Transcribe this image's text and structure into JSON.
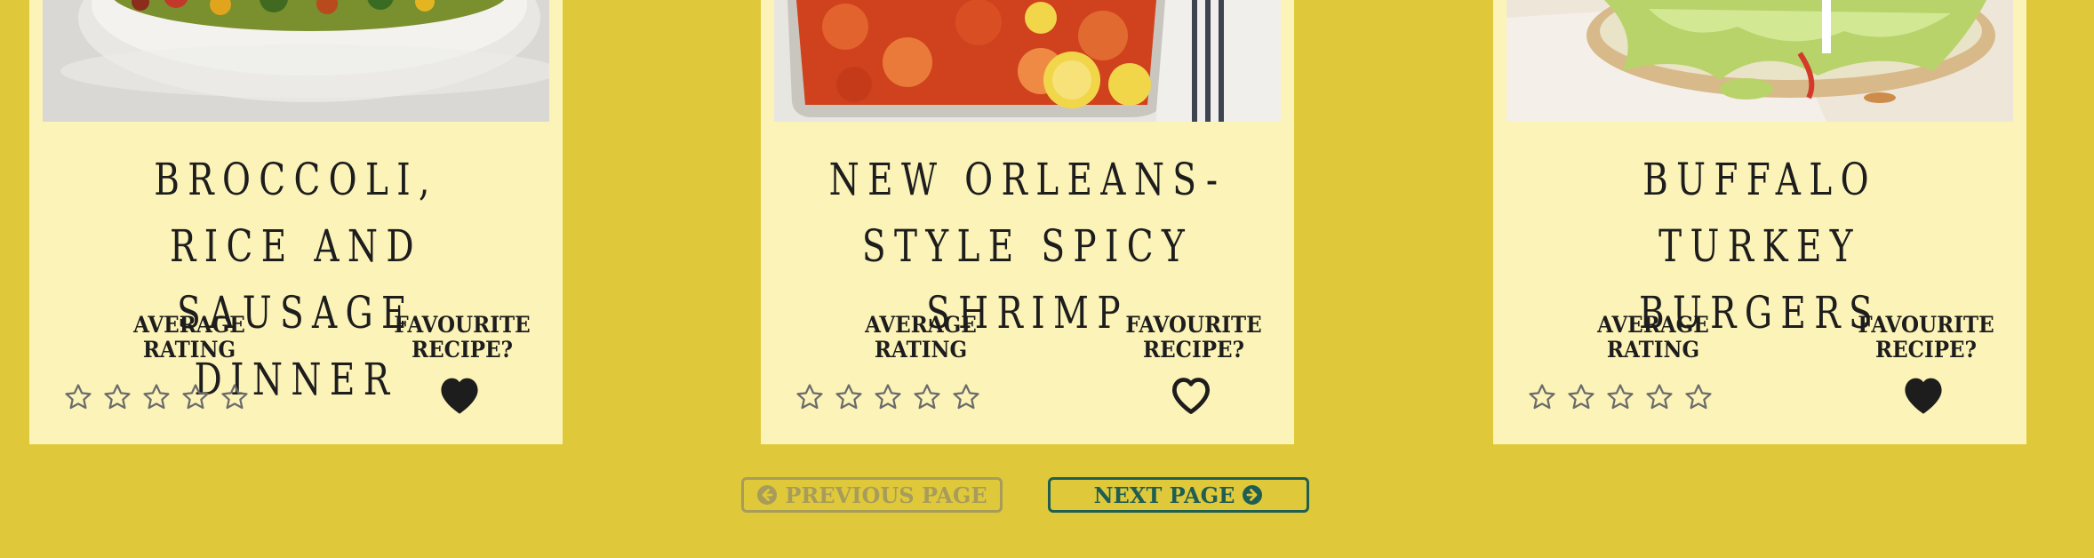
{
  "recipes": [
    {
      "title": "BROCCOLI, RICE AND SAUSAGE DINNER",
      "rating_label": "AVERAGE RATING",
      "favourite_label": "FAVOURITE RECIPE?",
      "rating_stars": 0,
      "favourite": true
    },
    {
      "title": "NEW ORLEANS-STYLE SPICY SHRIMP",
      "rating_label": "AVERAGE RATING",
      "favourite_label": "FAVOURITE RECIPE?",
      "rating_stars": 0,
      "favourite": false
    },
    {
      "title": "BUFFALO TURKEY BURGERS",
      "rating_label": "AVERAGE RATING",
      "favourite_label": "FAVOURITE RECIPE?",
      "rating_stars": 0,
      "favourite": true
    }
  ],
  "pagination": {
    "prev_label": "PREVIOUS PAGE",
    "next_label": "NEXT PAGE",
    "prev_disabled": true
  },
  "colors": {
    "background": "#dfc93a",
    "card": "#fcf3b8",
    "text": "#1d1d1d",
    "next_accent": "#1f5e52",
    "disabled": "#a89c5a"
  }
}
